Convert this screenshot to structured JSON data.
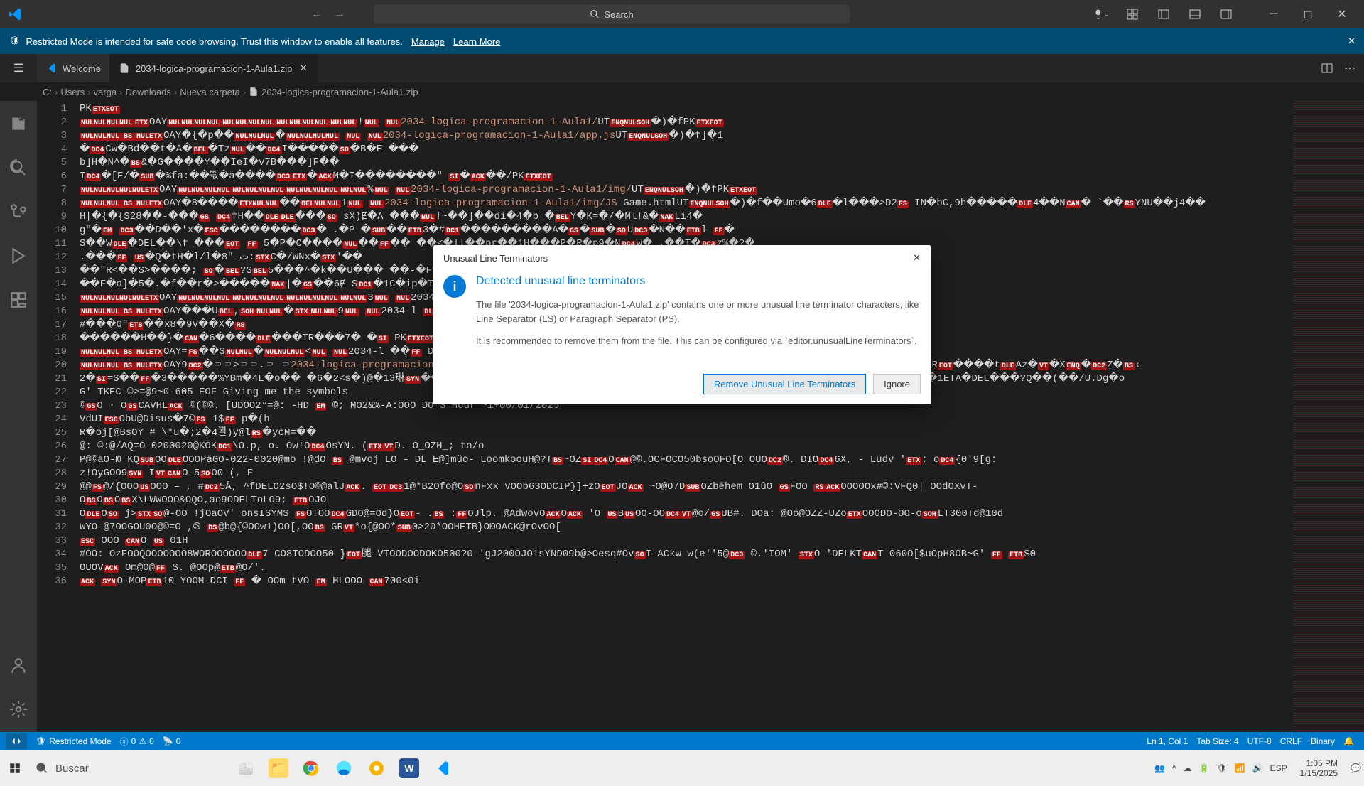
{
  "title_bar": {
    "search_placeholder": "Search"
  },
  "restricted_banner": {
    "message": "Restricted Mode is intended for safe code browsing. Trust this window to enable all features.",
    "manage": "Manage",
    "learn_more": "Learn More"
  },
  "tabs": {
    "welcome": "Welcome",
    "file": "2034-logica-programacion-1-Aula1.zip"
  },
  "breadcrumb": [
    "C:",
    "Users",
    "varga",
    "Downloads",
    "Nueva carpeta",
    "2034-logica-programacion-1-Aula1.zip"
  ],
  "code_lines": [
    "PKETXEOT",
    "NULNULNULNULETXOAYNULNULNULNULNULNULNULNULNULNULNULNULNULNUL!NUL NUL2034-logica-programacion-1-Aula1/UTENQNULSOH�)�fPKETXEOT",
    "NULNULNUL BS NULETXOAY�{�p��NULNULNUL�NULNULNULNUL NUL NUL2034-logica-programacion-1-Aula1/app.jsUTENQNULSOH�)�f]�1",
    "�DC4Cw�Bd��t�A�BEL�TzNUL��DC4I�����SO�B�E ���",
    "b]H�N^�BS&�G����Y��IeI�v7B���]F��",
    "IDC4�[E/�SUB�%fa:��쁷�a����DC3ETX�ACKM�I��������\" SI�ACK��/PKETXEOT",
    "NULNULNULNULNULETXOAYNULNULNULNULNULNULNULNULNULNULNULNULNULNUL%NUL NUL2034-logica-programacion-1-Aula1/img/UTENQNULSOH�)�fPKETXEOT",
    "NULNULNUL BS NULETXOAY�8����ETXNULNUL��BELNULNUL1NUL NUL2034-logica-programacion-1-Aula1/img/JS Game.htmlUTENQNULSOH�)�f��Umo�6DLE�l���>D2FS IN�bC,9h�����DLE4��NCAN�  `��RSYNU��j4��",
    "H|�{�{S28��-���GS DC4fH��DLEDLE���SO sX)Ɇ�Ʌ ���NUL!~��]��di�4�b_�BELY�K=�/�Ml!&�NAKLi4�",
    "g\"�EM DC3��D��'x�ESC��������DC3� .�P �SUB��ETB3�#DC1���������A�GS�SUB�SOUDC3�N��ETBl FF�",
    "S��WDLE�DEL��\\f_���EOT FF 5�P�C����NUL��FF�� ��<�ll��pr��1H���P�R�p9�NDC4W� .��T�DC3z%�?�",
    ".���FF US�Q�tH�l/l�8\"-ت:STXC�/WNx�STX'��",
    "��\"R<��S>����; SO�BEL?SBEL5���^�k��U��� ��-�Ff��k�7DC2c�J��+",
    "��F�o]�5�.�f��r�>�����NAK|�GS��6Ɇ SDC1�1C�ip�TvmL��NUL RS��S�w0���)�ESC��oT��",
    "NULNULNULNULNULETXOAYNULNULNULNULNULNULNULNULNULNULNULNULNULNUL3NUL NUL2034-",
    "NULNULNUL BS NULETXOAY���UBEL,SOHNULNUL�STXNULNUL9NUL NUL2034-l DLE��)>���Ã1W�NAKEOT SI RS ā>@�t4�d'l6�DLE���BS^�bƂ",
    "#���0\"ETB��x8�9V��X�RS",
    "������H��}�CAN�6����DLE���TR���7� �SI PKETXEOT",
    "NULNULNUL BS NULETXOAY=FS��SNULNUL�NULNULNUL<NUL NUL2034-l ��FF D�|��STXDC2)ETXS�5I�'\"�T�DC4�  ��EM�Bn:�{�",
    "NULNULNUL BS NULETXOAY9DC2�⸧⸧>⸧⸧.⸧  ⸧2034-logica-programacion-1-Aula1/img/Ruido.pngUTENQNULSOH�)�fL�gP�L ��DC�)J�J���'C��DC4l GS�NUL�!�&REOT����tDLEAz�VT�XENQ�DC2Ẓ�BS‹",
    "2�SI=S��FF�3�����%YBm�4L�o��  �6�2<s�)@�13琳SYN��*Xv鍇/��y7�ETB�DC4THZ�VddTjc����ETBWNAK�]c�cx� �'���u�����C�UB�,;VJ�1ETA�DEL���?Q��(��/U.Dg�o",
    "G' TKEC ©>=@9~0-605 EOF Giving me the symbols",
    "©GSO · OGSCAVHLACK ©(©©. [UDOO2°=@: -HD EM ©; MO2&%-A:OOO DO S Hour ~i+00/01/2025",
    "VdUIESCObU@Disus�7©FS 1$FF p�(h",
    "R�oj[@BsOY   # \\*u�;2�4꾈)y@lRS�ycM=��",
    "@: ©:@/AQ=O-0200020@KOKDC1\\O.p, o. Ow!ODC4OsYN. (ETXVTD. O_OZH_; to/o",
    "P@©aO-Ю  KQSUBOODLEOOOPäGO-022-0020@mo !@dO BS @mvoj LO – DL  E@]müo- LoomkoouH@?TBS~OZSIDC4OCAN@©.OCFOCO50bsoOFO[O  OUODC2®. DIODC46X, - Ludv 'ETX; oDC4{0'9[g:",
    "z!OyGOO9SYN IVTCANO-5SOO0 (, F ",
    "@@FS@/{OOOUSOOO – , #DC25Å, ^fDELO2sO$!O©@alJACK. EOTDC31@*B2Ofo@OSOnFxx vOOb63ODCIP}]+zOEOTJOACK ~O@O7DSUBOZběhem O1ûO GSFOO RSACKOOOOOx#©:VFQ0| OOdOXvT-",
    "OBSOBSOBSX\\LWWOOO&OQO,ao9ODELToLO9; ETBOJO",
    "ODLEOSO j>STXSO@-OO !jOaOV' onsISYMS FSO!OODC4GDO@=Od}OEOT- .BS :FFOJlp. @AdwovOACKOACK 'O USBUSOO-OODC4VT@o/GSUB#. DOa: @Oo@OZZ-UZoETXOOODO-OO-oSOHLT300Td@10d",
    "WYO-@7OOGOU0O@©=O ,⧁ BS@b@{©OOw1)OO[,OOBS GRVT*о{@OO*SUB0>20*ООНЕТВ}ОЮОАСК@rOvOO[",
    "ESC OOO CANO US 01H",
    "#OO: OzFOOQOOOOOOO8WOROOOOOODLE7    CO8TODOO50 }EOT腿 VТOODOODOKO500?0 'gJ200OJO1sYND09b@>Oesq#OvSOI ACkw w(e''5@DC3 ©.'IOM' STXO 'DELKTCANT 060O[$uOpH8OB~G' FF ETB$0",
    "OUOVACK Om@O@FF S. @OOp@ETB@O/'. ",
    "ACK SYNO-MOPETB10  YOOM-DCI FF � OOm tVO EM HLOOO CAN700<0i"
  ],
  "dialog": {
    "title": "Unusual Line Terminators",
    "heading": "Detected unusual line terminators",
    "text1": "The file '2034-logica-programacion-1-Aula1.zip' contains one or more unusual line terminator characters, like Line Separator (LS) or Paragraph Separator (PS).",
    "text2": "It is recommended to remove them from the file. This can be configured via `editor.unusualLineTerminators`.",
    "btn_primary": "Remove Unusual Line Terminators",
    "btn_secondary": "Ignore"
  },
  "status_bar": {
    "restricted": "Restricted Mode",
    "errors": "0",
    "warnings": "0",
    "ports": "0",
    "cursor": "Ln 1, Col 1",
    "tab_size": "Tab Size: 4",
    "encoding": "UTF-8",
    "eol": "CRLF",
    "lang": "Binary"
  },
  "taskbar": {
    "search_placeholder": "Buscar",
    "lang": "ESP",
    "time": "1:05 PM",
    "date": "1/15/2025"
  }
}
